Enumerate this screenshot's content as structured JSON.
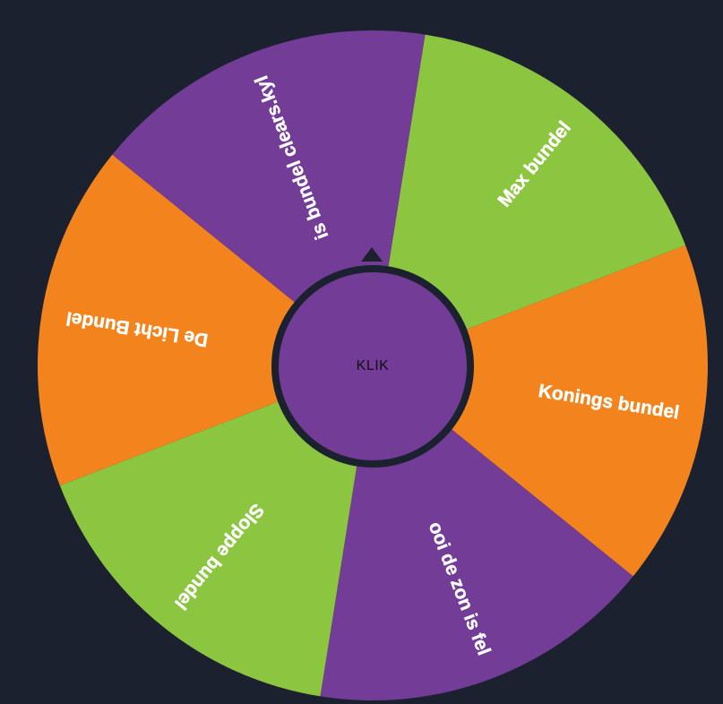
{
  "wheel": {
    "segments": [
      {
        "label": "Max bundel",
        "color": "#8cc540"
      },
      {
        "label": "Konings bundel",
        "color": "#f3841d"
      },
      {
        "label": "ooi de zon is fel",
        "color": "#733c97"
      },
      {
        "label": "Sloppe bundel",
        "color": "#8cc540"
      },
      {
        "label": "De Licht Bundel",
        "color": "#f3841d"
      },
      {
        "label": "is bundel clears.kyl",
        "color": "#733c97"
      }
    ],
    "center_label": "KLIK"
  },
  "colors": {
    "background": "#1c2130",
    "hub": "#733c97",
    "pointer": "#1c2130"
  }
}
